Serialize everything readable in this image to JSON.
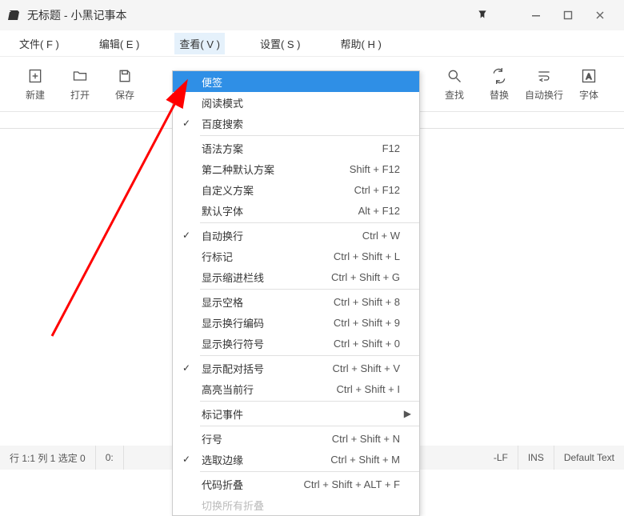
{
  "title": "无标题 - 小黑记事本",
  "menubar": {
    "file": "文件( F )",
    "edit": "编辑( E )",
    "view": "查看( V )",
    "setting": "设置( S )",
    "help": "帮助( H )"
  },
  "toolbar": {
    "new": "新建",
    "open": "打开",
    "save": "保存",
    "find": "查找",
    "replace": "替换",
    "wrap": "自动换行",
    "font": "字体"
  },
  "dropdown": {
    "items": [
      {
        "check": "",
        "label": "便签",
        "shortcut": "",
        "submenu": false,
        "selected": true,
        "disabled": false
      },
      {
        "check": "",
        "label": "阅读模式",
        "shortcut": "",
        "submenu": false,
        "selected": false,
        "disabled": false
      },
      {
        "check": "✓",
        "label": "百度搜索",
        "shortcut": "",
        "submenu": false,
        "selected": false,
        "disabled": false
      },
      {
        "check": "",
        "label": "语法方案",
        "shortcut": "F12",
        "submenu": false,
        "selected": false,
        "disabled": false
      },
      {
        "check": "",
        "label": "第二种默认方案",
        "shortcut": "Shift + F12",
        "submenu": false,
        "selected": false,
        "disabled": false
      },
      {
        "check": "",
        "label": "自定义方案",
        "shortcut": "Ctrl + F12",
        "submenu": false,
        "selected": false,
        "disabled": false
      },
      {
        "check": "",
        "label": "默认字体",
        "shortcut": "Alt + F12",
        "submenu": false,
        "selected": false,
        "disabled": false
      },
      {
        "check": "✓",
        "label": "自动换行",
        "shortcut": "Ctrl + W",
        "submenu": false,
        "selected": false,
        "disabled": false
      },
      {
        "check": "",
        "label": "行标记",
        "shortcut": "Ctrl + Shift + L",
        "submenu": false,
        "selected": false,
        "disabled": false
      },
      {
        "check": "",
        "label": "显示缩进栏线",
        "shortcut": "Ctrl + Shift + G",
        "submenu": false,
        "selected": false,
        "disabled": false
      },
      {
        "check": "",
        "label": "显示空格",
        "shortcut": "Ctrl + Shift + 8",
        "submenu": false,
        "selected": false,
        "disabled": false
      },
      {
        "check": "",
        "label": "显示换行编码",
        "shortcut": "Ctrl + Shift + 9",
        "submenu": false,
        "selected": false,
        "disabled": false
      },
      {
        "check": "",
        "label": "显示换行符号",
        "shortcut": "Ctrl + Shift + 0",
        "submenu": false,
        "selected": false,
        "disabled": false
      },
      {
        "check": "✓",
        "label": "显示配对括号",
        "shortcut": "Ctrl + Shift + V",
        "submenu": false,
        "selected": false,
        "disabled": false
      },
      {
        "check": "",
        "label": "高亮当前行",
        "shortcut": "Ctrl + Shift + I",
        "submenu": false,
        "selected": false,
        "disabled": false
      },
      {
        "check": "",
        "label": "标记事件",
        "shortcut": "",
        "submenu": true,
        "selected": false,
        "disabled": false
      },
      {
        "check": "",
        "label": "行号",
        "shortcut": "Ctrl + Shift + N",
        "submenu": false,
        "selected": false,
        "disabled": false
      },
      {
        "check": "✓",
        "label": "选取边缘",
        "shortcut": "Ctrl + Shift + M",
        "submenu": false,
        "selected": false,
        "disabled": false
      },
      {
        "check": "",
        "label": "代码折叠",
        "shortcut": "Ctrl + Shift + ALT + F",
        "submenu": false,
        "selected": false,
        "disabled": false
      },
      {
        "check": "",
        "label": "切换所有折叠",
        "shortcut": "",
        "submenu": false,
        "selected": false,
        "disabled": true
      }
    ],
    "sep_after_indices": [
      2,
      6,
      9,
      12,
      14,
      15,
      17
    ]
  },
  "statusbar": {
    "pos": "行 1:1  列 1  选定 0",
    "zero": "0:",
    "lf": "-LF",
    "ins": "INS",
    "deftext": "Default Text"
  }
}
